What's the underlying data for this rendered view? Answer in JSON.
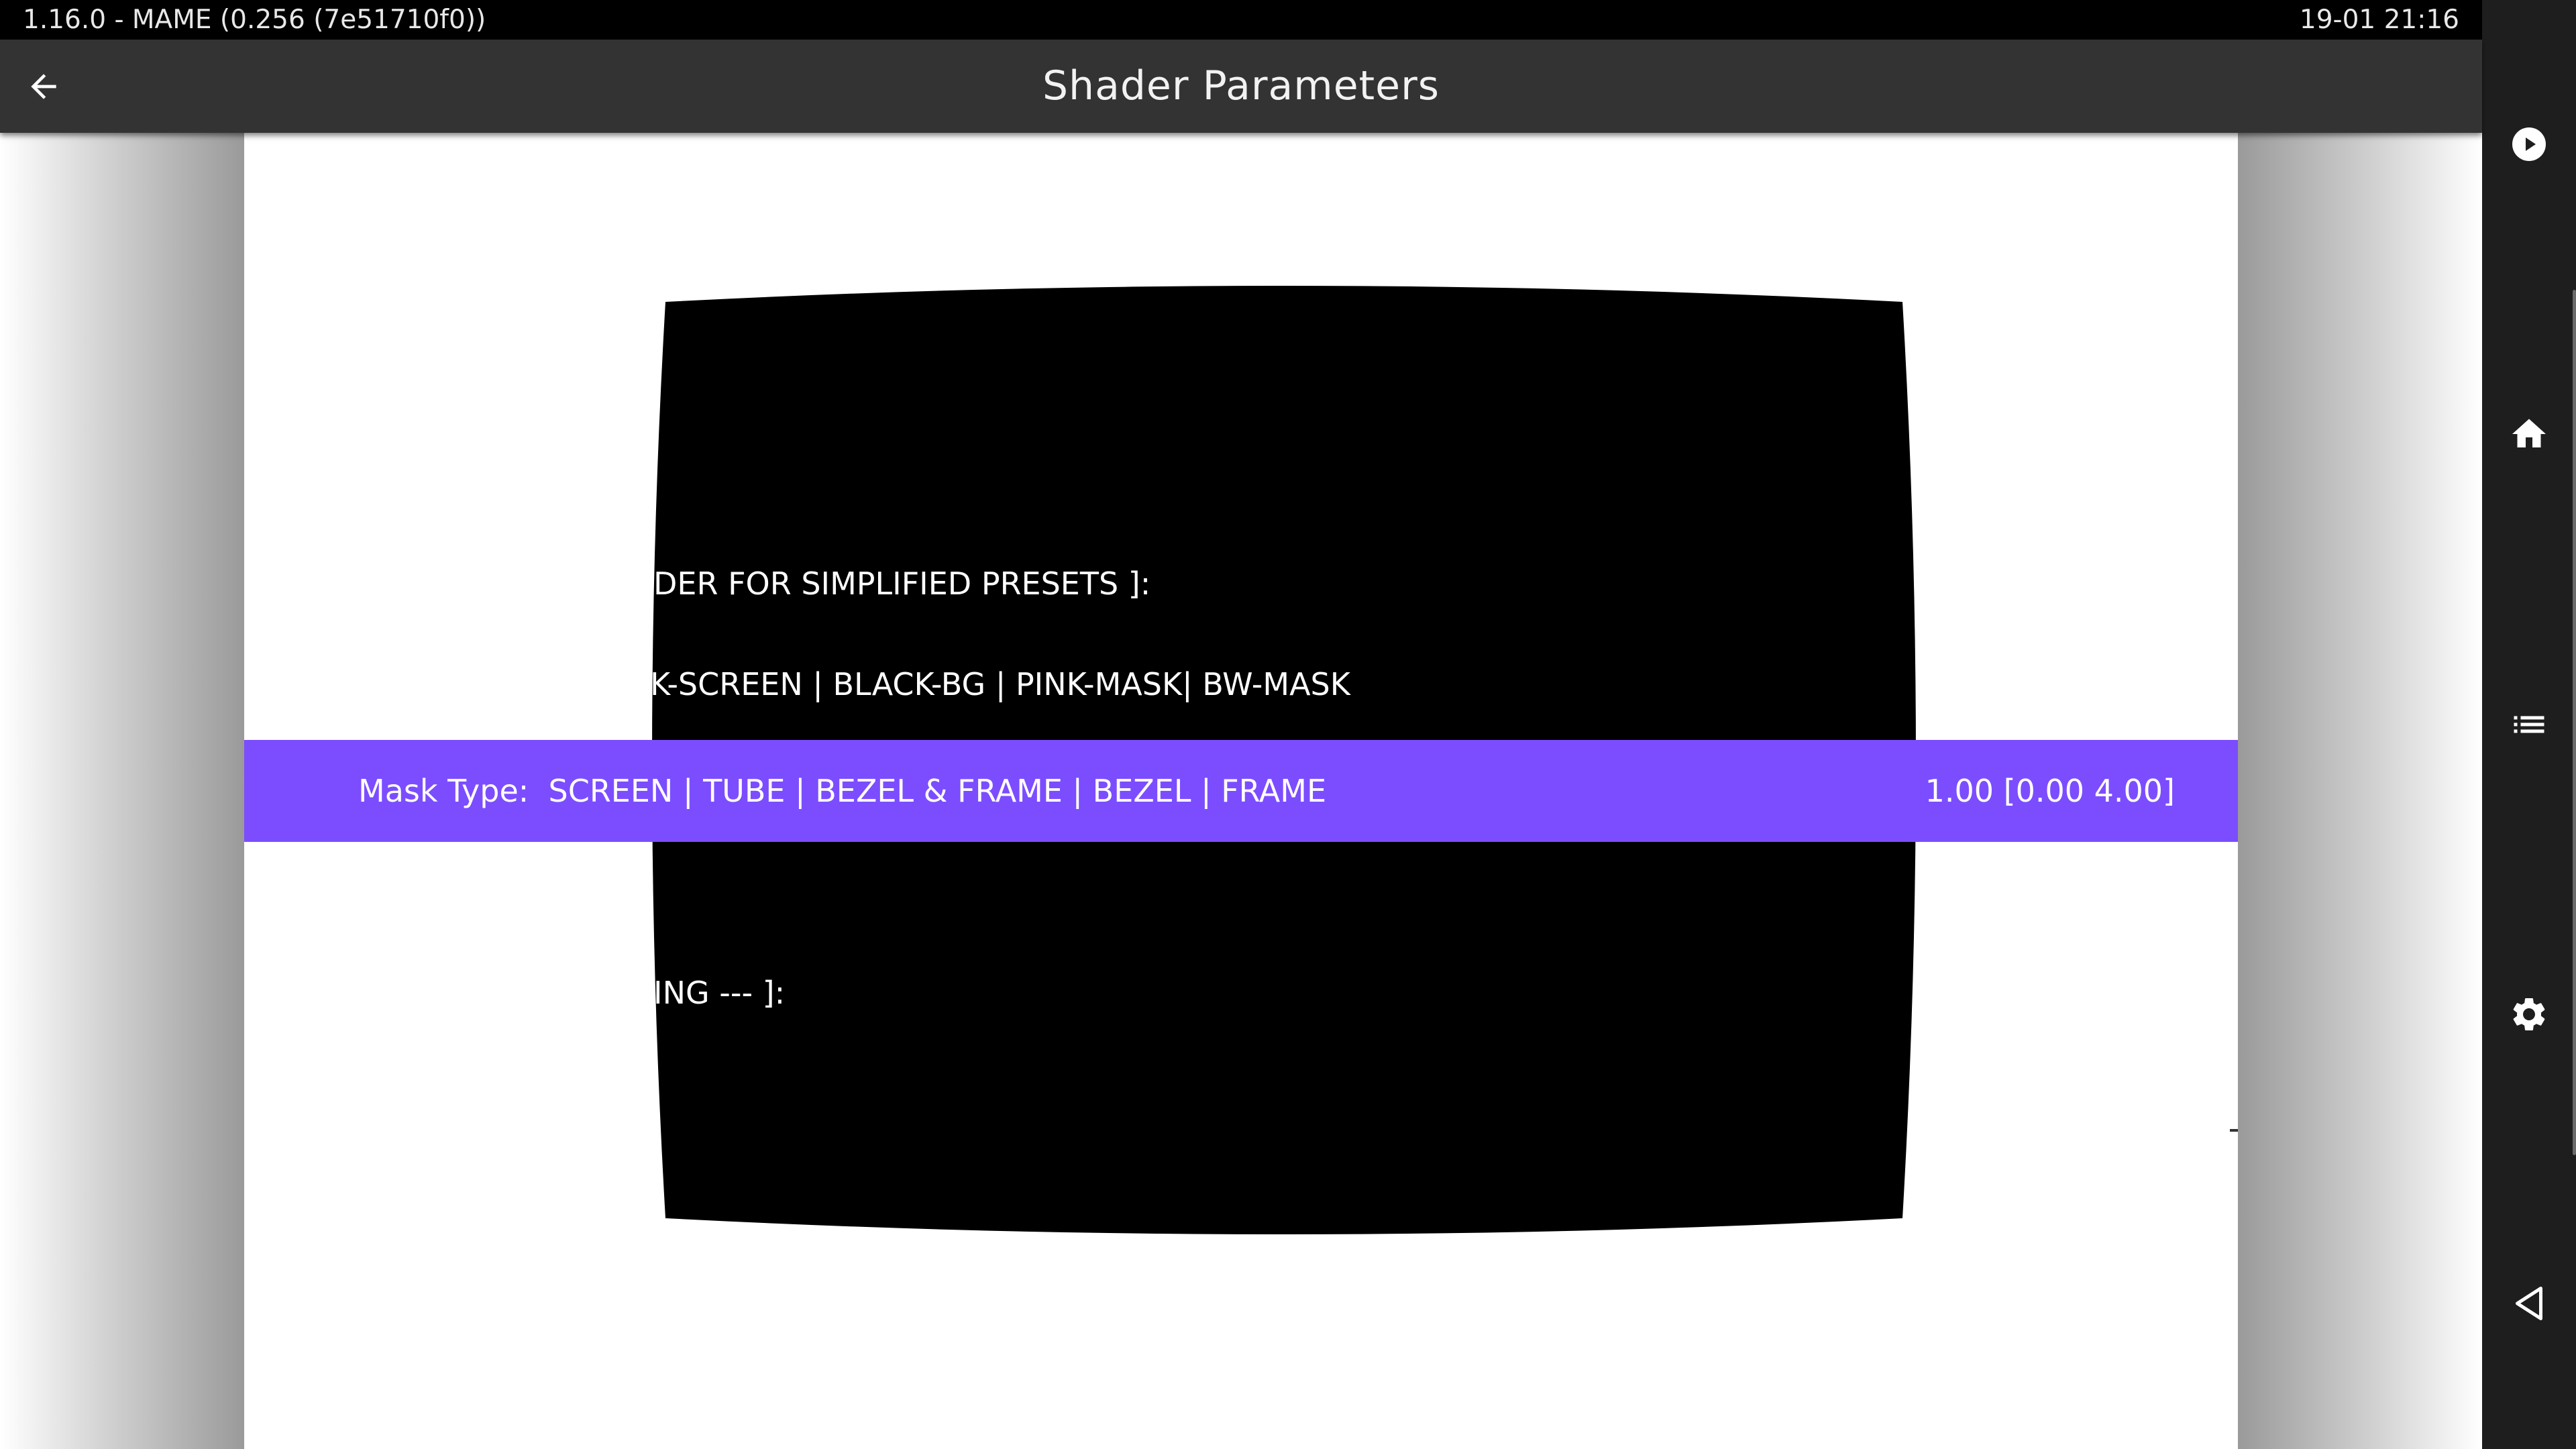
{
  "status_bar": {
    "app_version": "1.16.0 - MAME (0.256 (7e51710f0))",
    "datetime": "19-01 21:16"
  },
  "toolbar": {
    "title": "Shader Parameters",
    "back_icon": "arrow-left-icon"
  },
  "parameters": {
    "rows": [
      {
        "text": "DER FOR SIMPLIFIED PRESETS ]:"
      },
      {
        "text": "K-SCREEN | BLACK-BG | PINK-MASK| BW-MASK"
      },
      {
        "text": "ING --- ]:"
      }
    ],
    "selected": {
      "label": "Mask Type:  SCREEN | TUBE | BEZEL & FRAME | BEZEL | FRAME",
      "value": "1.00 [0.00 4.00]"
    }
  },
  "side_nav": {
    "items": [
      {
        "name": "play-icon"
      },
      {
        "name": "home-icon"
      },
      {
        "name": "list-icon"
      },
      {
        "name": "gear-icon"
      },
      {
        "name": "back-triangle-icon"
      }
    ]
  },
  "colors": {
    "accent": "#7c4dff",
    "toolbar": "#333333",
    "status_bar": "#000000",
    "side_rail": "#1e1e1e"
  }
}
